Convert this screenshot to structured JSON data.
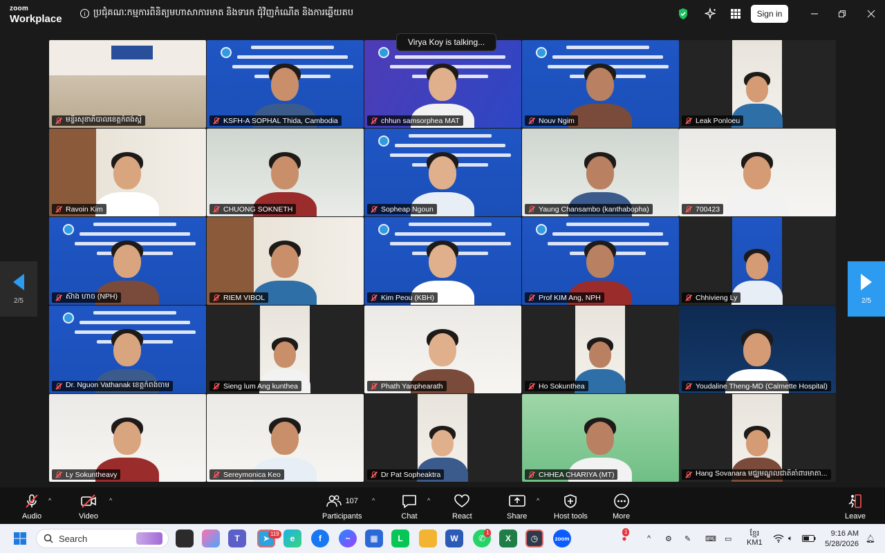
{
  "app": {
    "brand_top": "zoom",
    "brand_bottom": "Workplace",
    "meeting_title": "ប្រជុំគណៈកម្មការពិនិត្យមហាសាការមាត និងទារក ជុំវិញកំណើត និងការឆ្លើយតប",
    "sign_in_label": "Sign in"
  },
  "talking_indicator": "Virya Koy is talking...",
  "pager": {
    "left_label": "2/5",
    "right_label": "2/5"
  },
  "participants": [
    {
      "name": "មន្ទីរសុខាភិបាលខេត្តកំពង់ស្ពឺ",
      "kind": "room"
    },
    {
      "name": "KSFH-A SOPHAL Thida, Cambodia",
      "kind": "poster-person"
    },
    {
      "name": "chhun samsorphea MAT",
      "kind": "poster-purple"
    },
    {
      "name": "Nouv Ngim",
      "kind": "poster-person"
    },
    {
      "name": "Leak Ponloeu",
      "kind": "narrow"
    },
    {
      "name": "Ravoin Kim",
      "kind": "office"
    },
    {
      "name": "CHUONG SOKNETH",
      "kind": "plain"
    },
    {
      "name": "Sopheap Ngoun",
      "kind": "poster-person"
    },
    {
      "name": "Yaung Chansambo (kanthabopha)",
      "kind": "plain"
    },
    {
      "name": "700423",
      "kind": "plain-light"
    },
    {
      "name": "ស៊ាង ហាច (NPH)",
      "kind": "poster-person"
    },
    {
      "name": "RIEM VIBOL",
      "kind": "office"
    },
    {
      "name": "Kim Peou (KBH)",
      "kind": "poster-person"
    },
    {
      "name": "Prof KIM Ang, NPH",
      "kind": "poster-person"
    },
    {
      "name": "Chhivieng Ly",
      "kind": "narrow-poster"
    },
    {
      "name": "Dr. Nguon Vathanak ខេត្តកំពង់ចាម",
      "kind": "poster-person"
    },
    {
      "name": "Sieng lum Ang kunthea",
      "kind": "narrow"
    },
    {
      "name": "Phath Yanphearath",
      "kind": "plain-light"
    },
    {
      "name": "Ho Sokunthea",
      "kind": "narrow"
    },
    {
      "name": "Youdaline Theng-MD (Calmette Hospital)",
      "kind": "dark-blue"
    },
    {
      "name": "Ly Sokuntheavy",
      "kind": "plain-light"
    },
    {
      "name": "Sereymonica Keo",
      "kind": "plain-light"
    },
    {
      "name": "Dr Pat Sopheaktra",
      "kind": "narrow"
    },
    {
      "name": "CHHEA CHARIYA (MT)",
      "kind": "green"
    },
    {
      "name": "Hang Sovanara មជ្ឈមណ្ឌលជាតិគាំពារមាតា...",
      "kind": "narrow"
    }
  ],
  "toolbar": {
    "audio": "Audio",
    "video": "Video",
    "participants": "Participants",
    "participants_count": "107",
    "chat": "Chat",
    "react": "React",
    "share": "Share",
    "host_tools": "Host tools",
    "more": "More",
    "leave": "Leave"
  },
  "taskbar": {
    "search_placeholder": "Search",
    "telegram_badge": "119",
    "whatsapp_badge": "1",
    "notif_badge": "1",
    "lang_top": "ខ្មែរ",
    "lang_bottom": "KM1",
    "time": "9:16 AM",
    "date": "5/28/2026"
  },
  "colors": {
    "zoom_blue": "#2d9bf0",
    "poster_blue": "#1f56c4",
    "mute_red": "#ff5b5b",
    "shield_green": "#1ec15f"
  }
}
